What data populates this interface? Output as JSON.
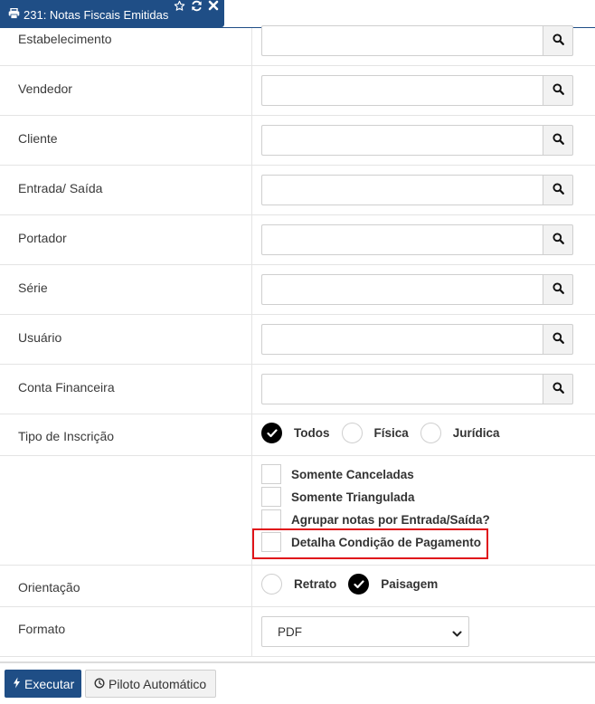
{
  "tab": {
    "title": "231: Notas Fiscais Emitidas",
    "icon": "printer-icon",
    "actions": [
      "star-icon",
      "refresh-icon",
      "close-icon"
    ]
  },
  "fields": [
    {
      "label": "Estabelecimento",
      "value": "",
      "search_icon": "search-icon"
    },
    {
      "label": "Vendedor",
      "value": "",
      "search_icon": "search-icon"
    },
    {
      "label": "Cliente",
      "value": "",
      "search_icon": "search-icon"
    },
    {
      "label": "Entrada/ Saída",
      "value": "",
      "search_icon": "search-icon"
    },
    {
      "label": "Portador",
      "value": "",
      "search_icon": "search-icon"
    },
    {
      "label": "Série",
      "value": "",
      "search_icon": "search-icon"
    },
    {
      "label": "Usuário",
      "value": "",
      "search_icon": "search-icon"
    },
    {
      "label": "Conta Financeira",
      "value": "",
      "search_icon": "search-icon"
    }
  ],
  "tipo_inscricao": {
    "label": "Tipo de Inscrição",
    "options": [
      {
        "label": "Todos",
        "checked": true
      },
      {
        "label": "Física",
        "checked": false
      },
      {
        "label": "Jurídica",
        "checked": false
      }
    ]
  },
  "checkboxes": [
    {
      "label": "Somente Canceladas",
      "checked": false
    },
    {
      "label": "Somente Triangulada",
      "checked": false
    },
    {
      "label": "Agrupar notas por Entrada/Saída?",
      "checked": false
    },
    {
      "label": "Detalha Condição de Pagamento",
      "checked": false,
      "highlighted": true
    }
  ],
  "orientacao": {
    "label": "Orientação",
    "options": [
      {
        "label": "Retrato",
        "checked": false
      },
      {
        "label": "Paisagem",
        "checked": true
      }
    ]
  },
  "formato": {
    "label": "Formato",
    "selected": "PDF"
  },
  "footer": {
    "execute_label": "Executar",
    "pilot_label": "Piloto Automático"
  },
  "colors": {
    "primary": "#1f4e86",
    "highlight": "#e0141a"
  }
}
